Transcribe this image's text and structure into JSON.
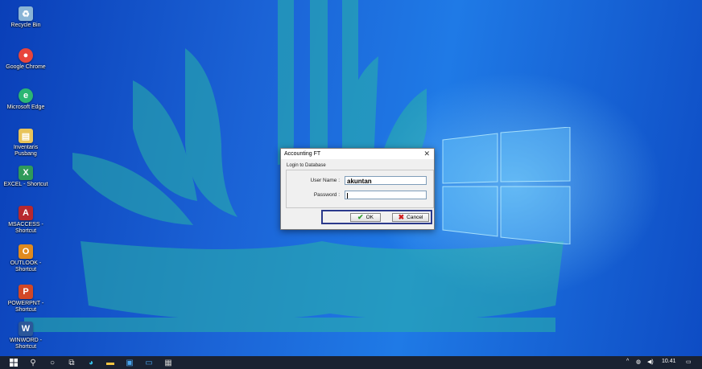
{
  "desktop_icons": [
    {
      "label": "Recycle Bin",
      "icon": "recycle-bin-icon",
      "color": "#8ab4d6"
    },
    {
      "label": "Google Chrome",
      "icon": "chrome-icon",
      "color": "#e8453c"
    },
    {
      "label": "Microsoft Edge",
      "icon": "edge-icon",
      "color": "#2bb673"
    },
    {
      "label": "Inventaris Pusbang",
      "icon": "app-icon",
      "color": "#e8c45a"
    },
    {
      "label": "EXCEL - Shortcut",
      "icon": "excel-icon",
      "color": "#2f9a5a"
    },
    {
      "label": "MSACCESS - Shortcut",
      "icon": "access-icon",
      "color": "#b7282e"
    },
    {
      "label": "OUTLOOK - Shortcut",
      "icon": "outlook-icon",
      "color": "#e08a1e"
    },
    {
      "label": "POWERPNT - Shortcut",
      "icon": "powerpoint-icon",
      "color": "#d24726"
    },
    {
      "label": "WINWORD - Shortcut",
      "icon": "word-icon",
      "color": "#2b579a"
    }
  ],
  "dialog": {
    "title": "Accounting FT",
    "close_glyph": "✕",
    "section": "Login to Database",
    "username_label": "User Name :",
    "username_value": "akuntan",
    "password_label": "Password :",
    "password_value": "",
    "ok_label": "OK",
    "cancel_label": "Cancel"
  },
  "taskbar": {
    "icons": [
      "start-icon",
      "search-icon",
      "cortana-icon",
      "task-view-icon",
      "edge-icon",
      "file-explorer-icon",
      "store-icon",
      "mail-icon",
      "app-icon"
    ],
    "tray_chevron": "^",
    "time": "10.41"
  }
}
